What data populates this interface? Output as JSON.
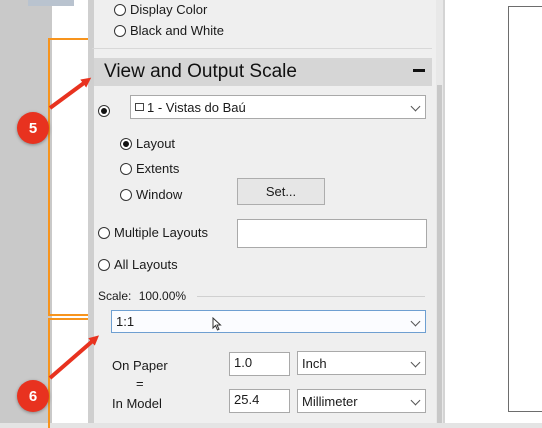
{
  "color_mode": {
    "display_color": "Display Color",
    "black_and_white": "Black and White"
  },
  "section": {
    "title": "View and Output Scale",
    "collapse_symbol": "−"
  },
  "view_dropdown": {
    "value": "1 - Vistas do Baú"
  },
  "extent_options": {
    "layout": "Layout",
    "extents": "Extents",
    "window": "Window",
    "set_button": "Set..."
  },
  "multiple_layouts": {
    "label": "Multiple Layouts",
    "value": ""
  },
  "all_layouts": {
    "label": "All Layouts"
  },
  "scale": {
    "label": "Scale:",
    "value": "100.00%",
    "dropdown_value": "1:1"
  },
  "paper": {
    "on_paper_label": "On Paper",
    "equals": "=",
    "in_model_label": "In Model",
    "paper_value": "1.0",
    "paper_unit": "Inch",
    "model_value": "25.4",
    "model_unit": "Millimeter"
  },
  "annotations": {
    "badge_5": "5",
    "badge_6": "6",
    "color": "#e8321f"
  }
}
